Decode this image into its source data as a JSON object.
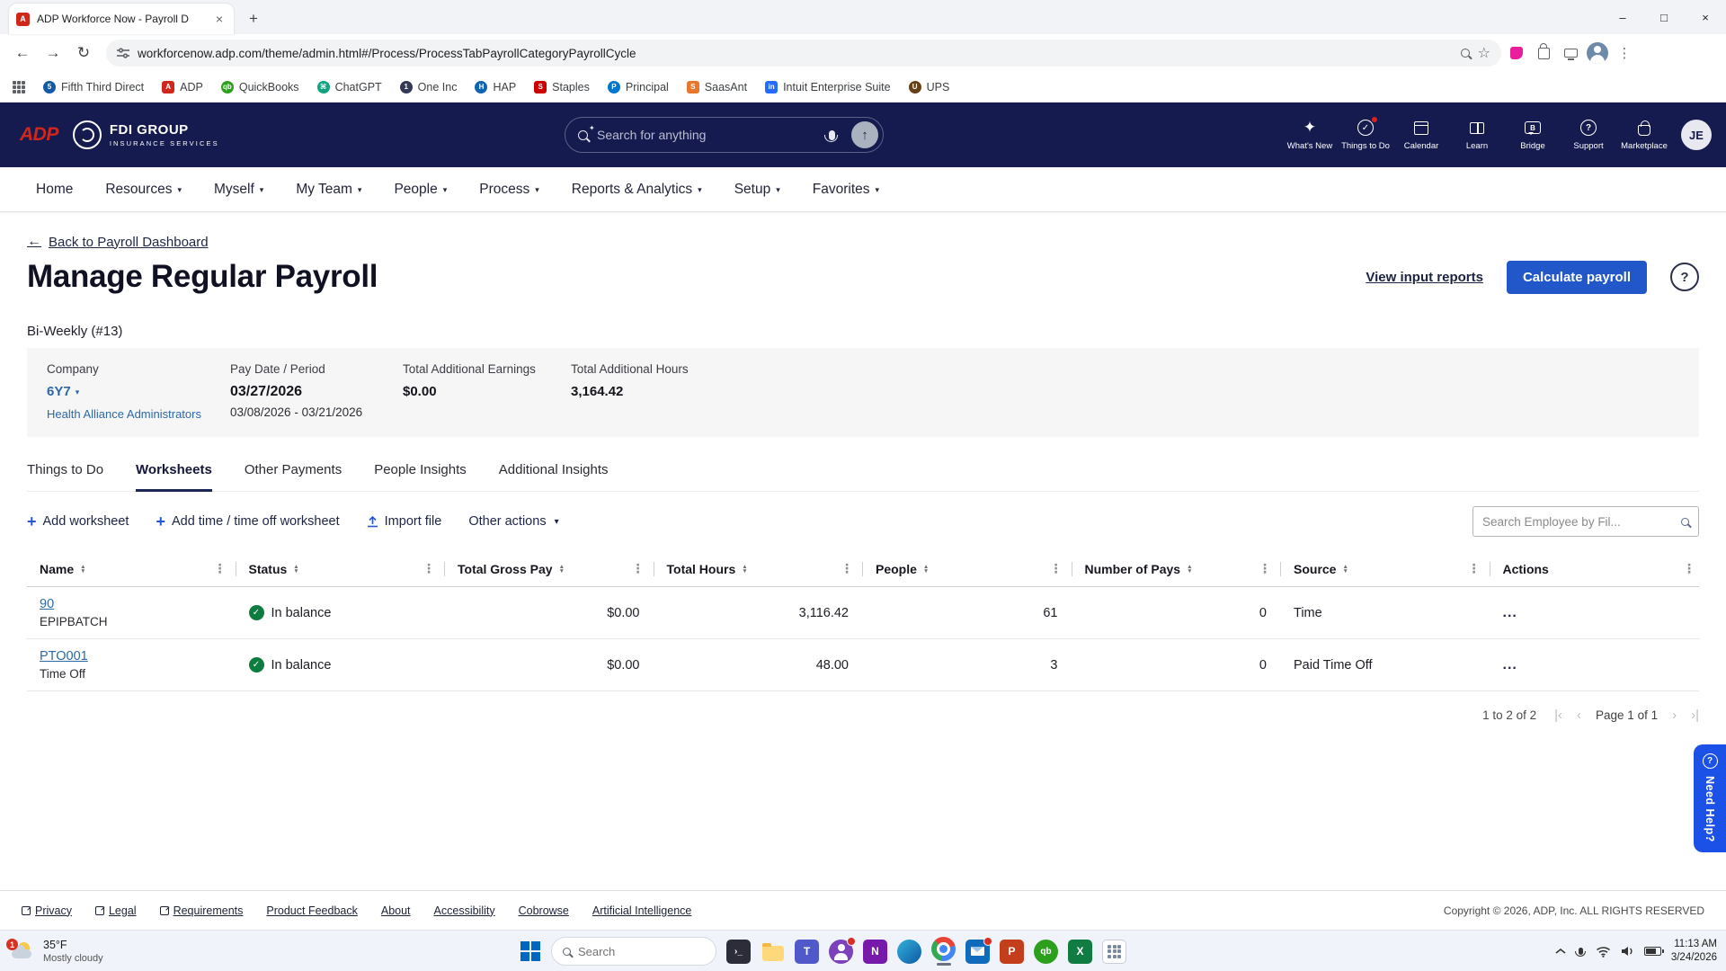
{
  "colors": {
    "header_navy": "#151b4e",
    "accent_blue": "#2257c9",
    "help_blue": "#1c51e8",
    "link_blue": "#2d68a8",
    "success_green": "#0d7d3f",
    "adp_red": "#d0271d"
  },
  "icons": {
    "back": "←",
    "forward": "→",
    "reload": "↻",
    "star": "☆",
    "kebab": "⋮",
    "tab_close": "×",
    "new_tab": "+",
    "minimize": "–",
    "maximize": "□",
    "close": "×",
    "sparkle": "✦",
    "check": "✓",
    "question": "?",
    "caret": "▾",
    "plus": "+",
    "up_arrow": "↑",
    "sort_asc": "▲",
    "sort_desc": "▼",
    "col_kebab": "⋮",
    "ellipsis": "...",
    "pg_first": "|‹",
    "pg_prev": "‹",
    "pg_next": "›",
    "pg_last": "›|",
    "letter_b": "B",
    "terminal": "›_",
    "teams": "T",
    "onenote": "N",
    "powerpoint": "P",
    "quickbooks": "qb",
    "excel": "X",
    "outlook": "O"
  },
  "browser": {
    "tab_title": "ADP Workforce Now - Payroll D",
    "url": "workforcenow.adp.com/theme/admin.html#/Process/ProcessTabPayrollCategoryPayrollCycle",
    "bookmarks": [
      {
        "label": "Fifth Third Direct"
      },
      {
        "label": "ADP"
      },
      {
        "label": "QuickBooks"
      },
      {
        "label": "ChatGPT"
      },
      {
        "label": "One Inc"
      },
      {
        "label": "HAP"
      },
      {
        "label": "Staples"
      },
      {
        "label": "Principal"
      },
      {
        "label": "SaasAnt"
      },
      {
        "label": "Intuit Enterprise Suite"
      },
      {
        "label": "UPS"
      }
    ]
  },
  "header": {
    "logo_text": "ADP",
    "company_name": "FDI GROUP",
    "company_tagline": "INSURANCE SERVICES",
    "search_placeholder": "Search for anything",
    "icons": [
      {
        "label": "What's New"
      },
      {
        "label": "Things to Do"
      },
      {
        "label": "Calendar"
      },
      {
        "label": "Learn"
      },
      {
        "label": "Bridge"
      },
      {
        "label": "Support"
      },
      {
        "label": "Marketplace"
      }
    ],
    "avatar_initials": "JE"
  },
  "nav": {
    "items": [
      {
        "label": "Home"
      },
      {
        "label": "Resources"
      },
      {
        "label": "Myself"
      },
      {
        "label": "My Team"
      },
      {
        "label": "People"
      },
      {
        "label": "Process"
      },
      {
        "label": "Reports & Analytics"
      },
      {
        "label": "Setup"
      },
      {
        "label": "Favorites"
      }
    ]
  },
  "page": {
    "back_link": "Back to Payroll Dashboard",
    "title": "Manage Regular Payroll",
    "view_input_reports": "View input reports",
    "calculate_payroll": "Calculate payroll",
    "cycle": "Bi-Weekly (#13)",
    "summary": {
      "company_label": "Company",
      "company_code": "6Y7",
      "company_name": "Health Alliance Administrators",
      "pay_label": "Pay Date / Period",
      "pay_date": "03/27/2026",
      "pay_period": "03/08/2026 - 03/21/2026",
      "earnings_label": "Total Additional Earnings",
      "earnings_value": "$0.00",
      "hours_label": "Total Additional Hours",
      "hours_value": "3,164.42"
    },
    "tabs": [
      "Things to Do",
      "Worksheets",
      "Other Payments",
      "People Insights",
      "Additional Insights"
    ],
    "toolbar": {
      "add_worksheet": "Add worksheet",
      "add_time": "Add time / time off worksheet",
      "import_file": "Import file",
      "other_actions": "Other actions",
      "search_placeholder": "Search Employee by Fil..."
    },
    "table": {
      "columns": [
        "Name",
        "Status",
        "Total Gross Pay",
        "Total Hours",
        "People",
        "Number of Pays",
        "Source",
        "Actions"
      ],
      "rows": [
        {
          "name": "90",
          "subtitle": "EPIPBATCH",
          "status": "In balance",
          "total_gross_pay": "$0.00",
          "total_hours": "3,116.42",
          "people": "61",
          "number_of_pays": "0",
          "source": "Time"
        },
        {
          "name": "PTO001",
          "subtitle": "Time Off",
          "status": "In balance",
          "total_gross_pay": "$0.00",
          "total_hours": "48.00",
          "people": "3",
          "number_of_pays": "0",
          "source": "Paid Time Off"
        }
      ]
    },
    "pagination": {
      "range_label": "1 to 2 of 2",
      "page_label": "Page 1 of 1"
    }
  },
  "footer": {
    "links": [
      "Privacy",
      "Legal",
      "Requirements",
      "Product Feedback",
      "About",
      "Accessibility",
      "Cobrowse",
      "Artificial Intelligence"
    ],
    "copyright": "Copyright © 2026, ADP, Inc. ALL RIGHTS RESERVED"
  },
  "help": {
    "label": "Need Help?"
  },
  "taskbar": {
    "weather_temp": "35°F",
    "weather_desc": "Mostly cloudy",
    "weather_badge": "1",
    "search_placeholder": "Search",
    "time": "11:13 AM",
    "date": "3/24/2026"
  }
}
